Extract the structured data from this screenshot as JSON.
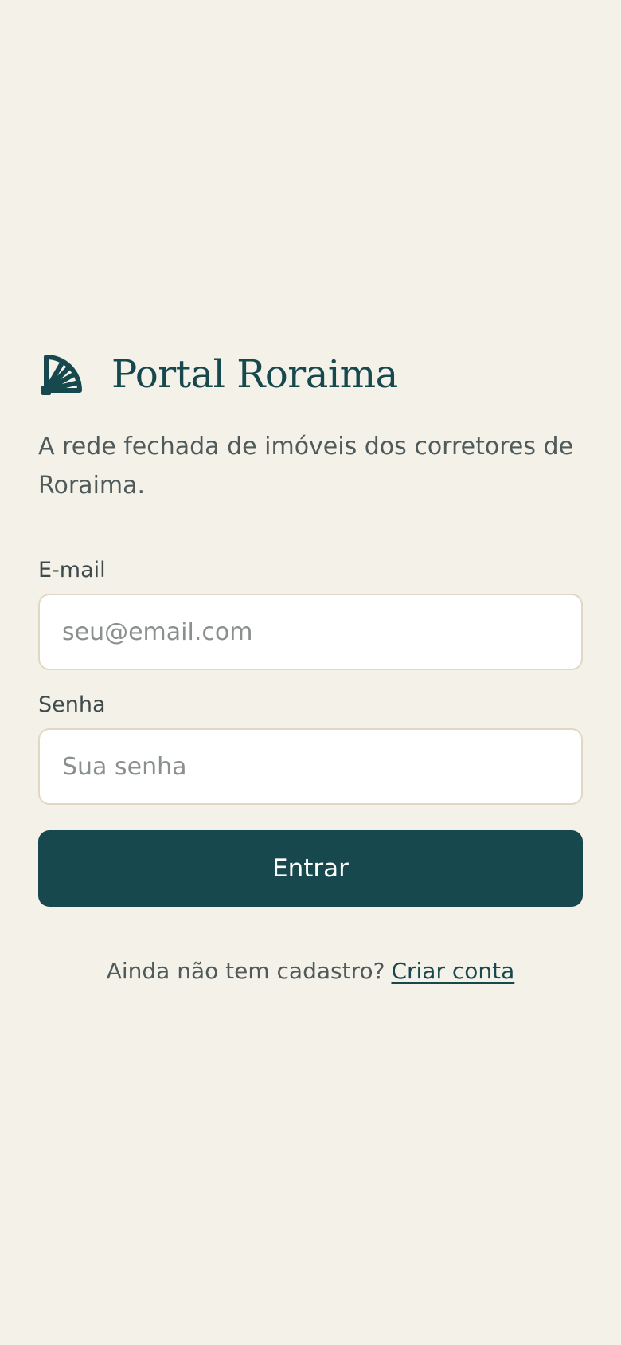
{
  "brand": {
    "name": "Portal Roraima",
    "icon": "fan-logo-icon",
    "color": "#16484D"
  },
  "tagline": "A rede fechada de imóveis dos corretores de Roraima.",
  "form": {
    "email_label": "E-mail",
    "email_placeholder": "seu@email.com",
    "email_value": "",
    "password_label": "Senha",
    "password_placeholder": "Sua senha",
    "password_value": "",
    "submit_label": "Entrar"
  },
  "signup": {
    "prompt": "Ainda não tem cadastro?",
    "link_label": "Criar conta"
  },
  "colors": {
    "background": "#F4F1E9",
    "primary": "#16484D",
    "input_border": "#E0D8C5"
  }
}
